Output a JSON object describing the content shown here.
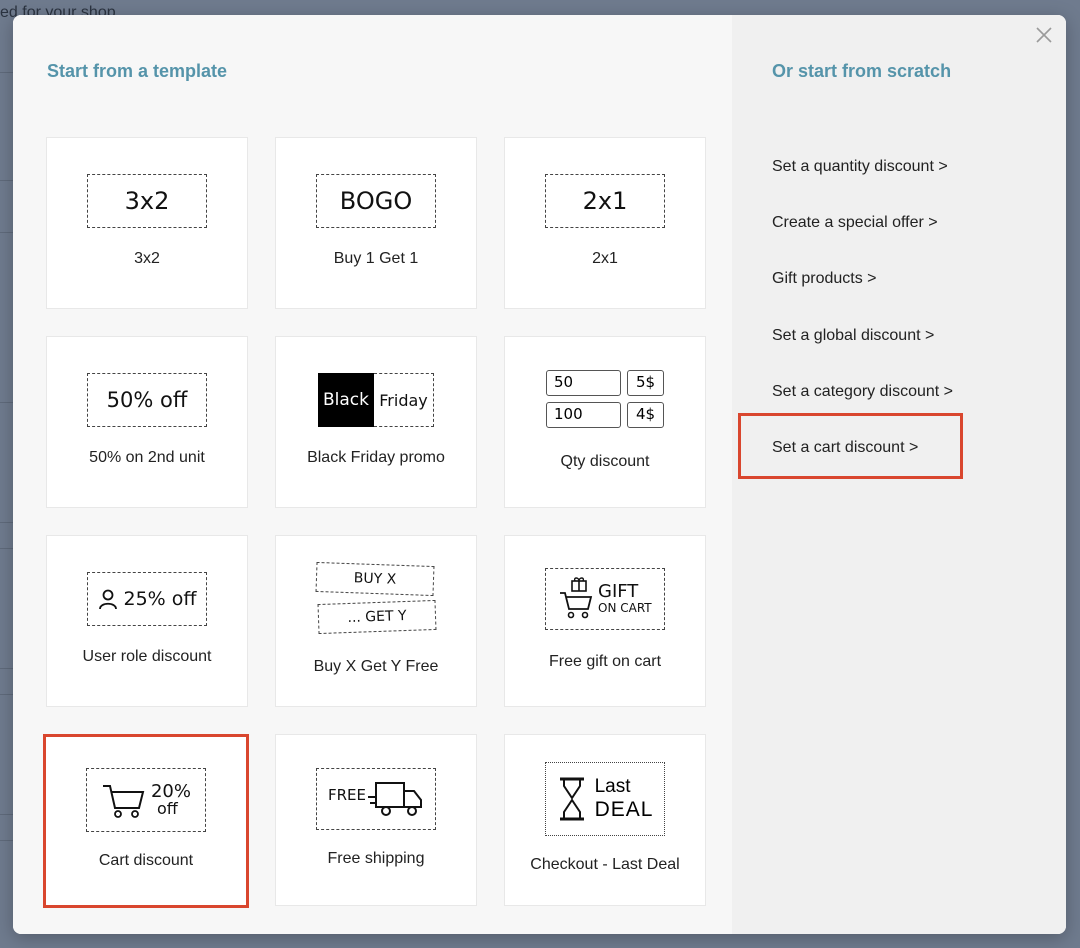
{
  "background": {
    "partial_text": "ed for your shop"
  },
  "modal": {
    "left_title": "Start from a template",
    "right_title": "Or start from scratch",
    "close_glyph": "×"
  },
  "templates": [
    {
      "label": "3x2",
      "badge": "3x2"
    },
    {
      "label": "Buy 1 Get 1",
      "badge": "BOGO"
    },
    {
      "label": "2x1",
      "badge": "2x1"
    },
    {
      "label": "50% on 2nd unit",
      "badge": "50% off"
    },
    {
      "label": "Black Friday promo",
      "badge_left": "Black",
      "badge_right": "Friday"
    },
    {
      "label": "Qty discount",
      "qty": [
        "50",
        "100"
      ],
      "price": [
        "5$",
        "4$"
      ]
    },
    {
      "label": "User role discount",
      "badge": "25% off"
    },
    {
      "label": "Buy X Get Y Free",
      "badge_top": "BUY X",
      "badge_bottom": "... GET Y"
    },
    {
      "label": "Free gift on cart",
      "badge_top": "GIFT",
      "badge_bottom": "ON CART"
    },
    {
      "label": "Cart discount",
      "badge_top": "20%",
      "badge_bottom": "off"
    },
    {
      "label": "Free shipping",
      "badge": "FREE"
    },
    {
      "label": "Checkout - Last Deal",
      "badge_top": "Last",
      "badge_bottom": "DEAL"
    }
  ],
  "scratch_links": [
    "Set a quantity discount >",
    "Create a special offer >",
    "Gift products >",
    "Set a global discount >",
    "Set a category discount >",
    "Set a cart discount >"
  ],
  "colors": {
    "accent_title": "#5594aa",
    "highlight": "#d9462e"
  }
}
